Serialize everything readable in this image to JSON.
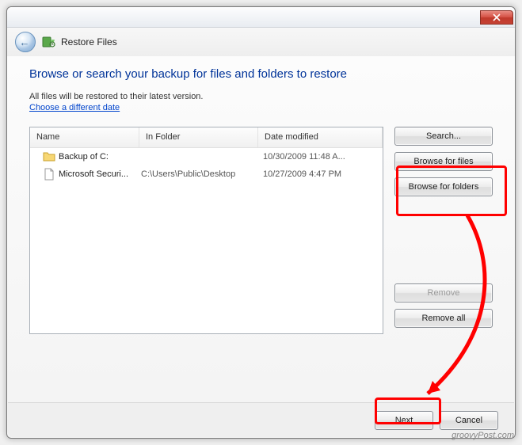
{
  "header": {
    "title": "Restore Files"
  },
  "heading": "Browse or search your backup for files and folders to restore",
  "subtext": "All files will be restored to their latest version.",
  "link": "Choose a different date",
  "columns": {
    "name": "Name",
    "folder": "In Folder",
    "date": "Date modified"
  },
  "items": [
    {
      "icon": "folder",
      "name": "Backup of C:",
      "folder": "",
      "date": "10/30/2009 11:48 A..."
    },
    {
      "icon": "file",
      "name": "Microsoft Securi...",
      "folder": "C:\\Users\\Public\\Desktop",
      "date": "10/27/2009 4:47 PM"
    }
  ],
  "buttons": {
    "search": "Search...",
    "browse_files": "Browse for files",
    "browse_folders": "Browse for folders",
    "remove": "Remove",
    "remove_all": "Remove all",
    "next": "Next",
    "cancel": "Cancel"
  },
  "watermark": "groovyPost.com"
}
